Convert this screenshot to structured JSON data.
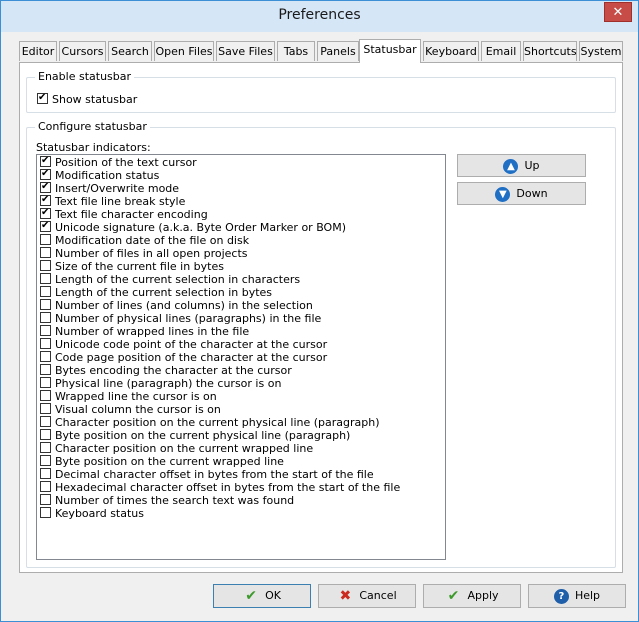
{
  "window": {
    "title": "Preferences"
  },
  "tabs": [
    {
      "label": "Editor"
    },
    {
      "label": "Cursors"
    },
    {
      "label": "Search"
    },
    {
      "label": "Open Files"
    },
    {
      "label": "Save Files"
    },
    {
      "label": "Tabs"
    },
    {
      "label": "Panels"
    },
    {
      "label": "Statusbar"
    },
    {
      "label": "Keyboard"
    },
    {
      "label": "Email"
    },
    {
      "label": "Shortcuts"
    },
    {
      "label": "System"
    }
  ],
  "active_tab": "Statusbar",
  "enable_group": {
    "title": "Enable statusbar",
    "show_label": "Show statusbar",
    "show_checked": true
  },
  "configure_group": {
    "title": "Configure statusbar",
    "list_label": "Statusbar indicators:"
  },
  "indicators": [
    {
      "label": "Position of the text cursor",
      "checked": true
    },
    {
      "label": "Modification status",
      "checked": true
    },
    {
      "label": "Insert/Overwrite mode",
      "checked": true
    },
    {
      "label": "Text file line break style",
      "checked": true
    },
    {
      "label": "Text file character encoding",
      "checked": true
    },
    {
      "label": "Unicode signature (a.k.a. Byte Order Marker or BOM)",
      "checked": true
    },
    {
      "label": "Modification date of the file on disk",
      "checked": false
    },
    {
      "label": "Number of files in all open projects",
      "checked": false
    },
    {
      "label": "Size of the current file in bytes",
      "checked": false
    },
    {
      "label": "Length of the current selection in characters",
      "checked": false
    },
    {
      "label": "Length of the current selection in bytes",
      "checked": false
    },
    {
      "label": "Number of lines (and columns) in the selection",
      "checked": false
    },
    {
      "label": "Number of physical lines (paragraphs) in the file",
      "checked": false
    },
    {
      "label": "Number of wrapped lines in the file",
      "checked": false
    },
    {
      "label": "Unicode code point of the character at the cursor",
      "checked": false
    },
    {
      "label": "Code page position of the character at the cursor",
      "checked": false
    },
    {
      "label": "Bytes encoding the character at the cursor",
      "checked": false
    },
    {
      "label": "Physical line (paragraph) the cursor is on",
      "checked": false
    },
    {
      "label": "Wrapped line the cursor is on",
      "checked": false
    },
    {
      "label": "Visual column the cursor is on",
      "checked": false
    },
    {
      "label": "Character position on the current physical line (paragraph)",
      "checked": false
    },
    {
      "label": "Byte position on the current physical line (paragraph)",
      "checked": false
    },
    {
      "label": "Character position on the current wrapped line",
      "checked": false
    },
    {
      "label": "Byte position on the current wrapped line",
      "checked": false
    },
    {
      "label": "Decimal character offset in bytes from the start of the file",
      "checked": false
    },
    {
      "label": "Hexadecimal character offset in bytes from the start of the file",
      "checked": false
    },
    {
      "label": "Number of times the search text was found",
      "checked": false
    },
    {
      "label": "Keyboard status",
      "checked": false
    }
  ],
  "side_buttons": {
    "up": "Up",
    "down": "Down",
    "up_icon": "arrow-up-icon",
    "down_icon": "arrow-down-icon"
  },
  "buttons": {
    "ok": "OK",
    "cancel": "Cancel",
    "apply": "Apply",
    "help": "Help",
    "ok_icon": "checkmark-icon",
    "cancel_icon": "red-x-icon",
    "apply_icon": "checkmark-icon",
    "help_icon": "question-icon"
  },
  "colors": {
    "accent": "#3c8fd4",
    "close": "#c74b46",
    "titlebar": "#d5e6f7"
  }
}
